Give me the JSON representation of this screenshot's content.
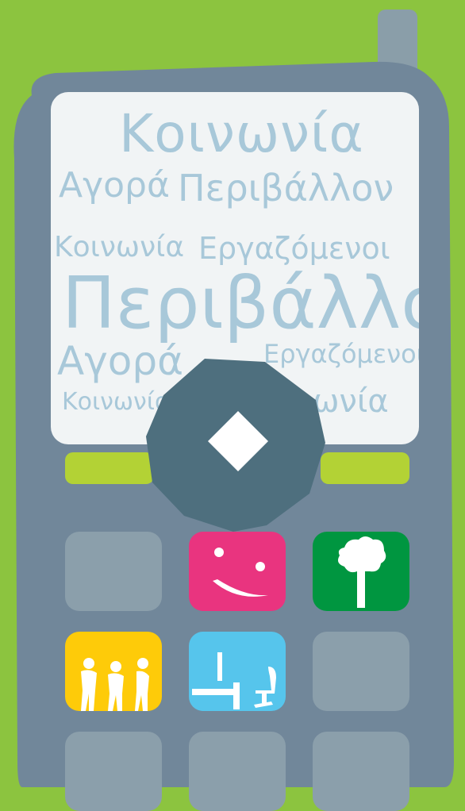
{
  "screen": {
    "words": [
      "Κοινωνία",
      "Αγορά",
      "Περιβάλλον",
      "Κοινωνία",
      "Εργαζόμενοι",
      "Περιβάλλον",
      "Αγορά",
      "Εργαζόμενοι",
      "Κοινωνία",
      "ωνία"
    ]
  },
  "colors": {
    "background": "#8cc43f",
    "phone_body": "#71879a",
    "screen": "#f1f4f5",
    "word": "#a8c8d9",
    "softkey": "#b3d235",
    "dpad": "#4e6f7e",
    "key_blank": "#8b9fab",
    "key_society": "#e9347f",
    "key_environment": "#009640",
    "key_employees": "#fecb09",
    "key_market": "#56c5ec"
  },
  "icons": {
    "dpad_center": "diamond-icon",
    "key2": "smiley-face-icon",
    "key3": "tree-icon",
    "key4": "people-group-icon",
    "key5": "office-desk-icon"
  }
}
